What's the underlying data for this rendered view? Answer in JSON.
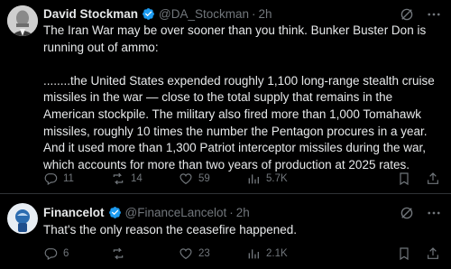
{
  "tweets": [
    {
      "name": "David Stockman",
      "handle": "@DA_Stockman",
      "time": "2h",
      "text": "The Iran War may be over sooner than you think. Bunker Buster Don is running out of ammo:\n\n........the United States expended roughly 1,100 long-range stealth cruise missiles in the war — close to the total supply that remains in the  American stockpile. The military also fired more than 1,000 Tomahawk  missiles, roughly 10 times the number the Pentagon procures in a year.  And it used more than 1,300 Patriot interceptor missiles during the war,  which accounts for more than two years of production at 2025 rates.",
      "replies": "11",
      "reposts": "14",
      "likes": "59",
      "views": "5.7K"
    },
    {
      "name": "Financelot",
      "handle": "@FinanceLancelot",
      "time": "2h",
      "text": "That's the only reason the ceasefire happened.",
      "replies": "6",
      "reposts": "",
      "likes": "23",
      "views": "2.1K"
    }
  ],
  "colors": {
    "accent": "#1d9bf0",
    "muted": "#71767b",
    "text": "#e7e9ea",
    "background": "#000000"
  },
  "icons": [
    "reply-icon",
    "repost-icon",
    "like-icon",
    "views-icon",
    "bookmark-icon",
    "share-icon",
    "grok-icon",
    "more-icon",
    "verified-icon"
  ]
}
